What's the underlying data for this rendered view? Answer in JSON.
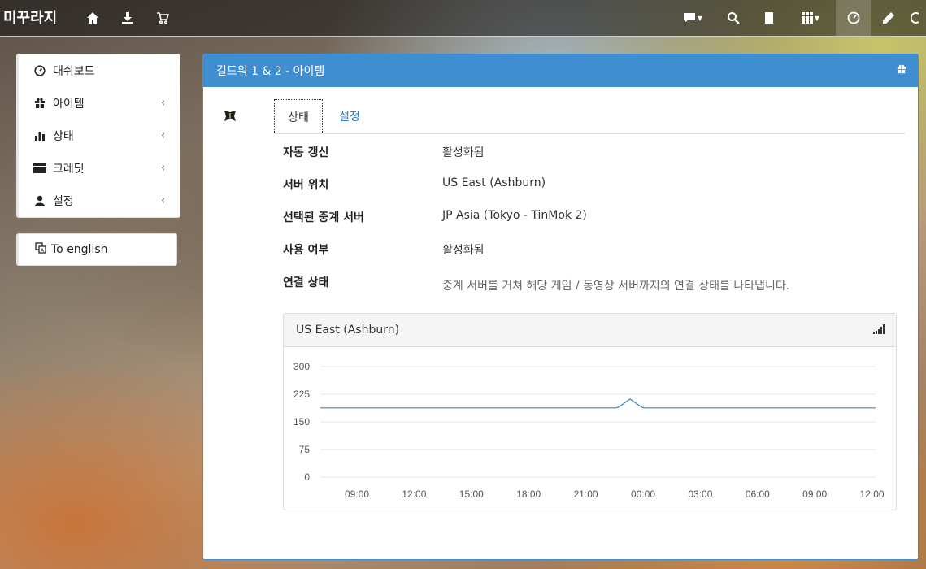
{
  "navbar": {
    "brand": "미꾸라지",
    "icons": [
      "home-icon",
      "download-icon",
      "cart-icon",
      "chat-icon",
      "search-icon",
      "book-icon",
      "grid-icon",
      "dashboard-icon",
      "pencil-icon",
      "logout-icon"
    ]
  },
  "sidebar": {
    "items": [
      {
        "label": "대쉬보드",
        "icon": "dashboard-icon",
        "has_chevron": false
      },
      {
        "label": "아이템",
        "icon": "gift-icon",
        "has_chevron": true
      },
      {
        "label": "상태",
        "icon": "bar-chart-icon",
        "has_chevron": true
      },
      {
        "label": "크레딧",
        "icon": "credit-card-icon",
        "has_chevron": true
      },
      {
        "label": "설정",
        "icon": "user-icon",
        "has_chevron": true
      }
    ],
    "language_button": "To english"
  },
  "panel": {
    "title": "길드워 1 & 2 - 아이템",
    "tabs": [
      {
        "label": "상태",
        "active": true
      },
      {
        "label": "설정",
        "active": false
      }
    ],
    "rows": [
      {
        "label": "자동 갱신",
        "value": "활성화됨"
      },
      {
        "label": "서버 위치",
        "value": "US East (Ashburn)"
      },
      {
        "label": "선택된 중계 서버",
        "value": "JP Asia (Tokyo - TinMok 2)"
      },
      {
        "label": "사용 여부",
        "value": "활성화됨"
      },
      {
        "label": "연결 상태",
        "value": "중계 서버를 거쳐 해당 게임 / 동영상 서버까지의 연결 상태를 나타냅니다."
      }
    ]
  },
  "chart_box_title": "US East (Ashburn)",
  "colors": {
    "panel_header": "#3e8ed0",
    "link": "#337ab7",
    "line": "#3a86c8"
  },
  "chart_data": {
    "type": "line",
    "title": "US East (Ashburn)",
    "xlabel": "",
    "ylabel": "",
    "ylim": [
      0,
      300
    ],
    "yticks": [
      300,
      225,
      150,
      75,
      0
    ],
    "x": [
      "09:00",
      "12:00",
      "15:00",
      "18:00",
      "21:00",
      "00:00",
      "03:00",
      "06:00",
      "09:00",
      "12:00"
    ],
    "series": [
      {
        "values": [
          188,
          188,
          188,
          188,
          188,
          188,
          188,
          188,
          188,
          188,
          188,
          188,
          188,
          188,
          188,
          188,
          188,
          188,
          188,
          188,
          188,
          188,
          188,
          188,
          188,
          188,
          188,
          188,
          188,
          188,
          188,
          188,
          188,
          188,
          188,
          188,
          188,
          188,
          188,
          188,
          188,
          188,
          188,
          188,
          188,
          188,
          188,
          188,
          188,
          188,
          188,
          188,
          188,
          188,
          188,
          188,
          188,
          188,
          188,
          188,
          188,
          188,
          188,
          188,
          188,
          188,
          188,
          188,
          188,
          188,
          188,
          188,
          188,
          188,
          188,
          188,
          188,
          188,
          188,
          188,
          188,
          188,
          188,
          188,
          188,
          188,
          188,
          188,
          188,
          188,
          188,
          188,
          188,
          188,
          188,
          188,
          188,
          188,
          188,
          188,
          188,
          188,
          188,
          188,
          188,
          188,
          188,
          188,
          188,
          188,
          188,
          188,
          188,
          188,
          188,
          188,
          188,
          188,
          188,
          188,
          188,
          188,
          188,
          188,
          188,
          188,
          188,
          188,
          188,
          188,
          188,
          188,
          188,
          188,
          188,
          188,
          188,
          188,
          188,
          188,
          188,
          188,
          188,
          188,
          188,
          188,
          188,
          188,
          188,
          188,
          188,
          188,
          188,
          188,
          188,
          188,
          188,
          188,
          188,
          188,
          188,
          188,
          188,
          188,
          188,
          188,
          188,
          188,
          188,
          188,
          188,
          188,
          188,
          188,
          188,
          188,
          188,
          188,
          188,
          188,
          188,
          188,
          188,
          188,
          188,
          188,
          188,
          188,
          188,
          188,
          188,
          188,
          188,
          188,
          188,
          188,
          188,
          188,
          188,
          188
        ],
        "spike": {
          "at": "23:10",
          "value": 212
        },
        "color": "#3a86c8"
      }
    ],
    "grid": true,
    "legend": "none"
  }
}
